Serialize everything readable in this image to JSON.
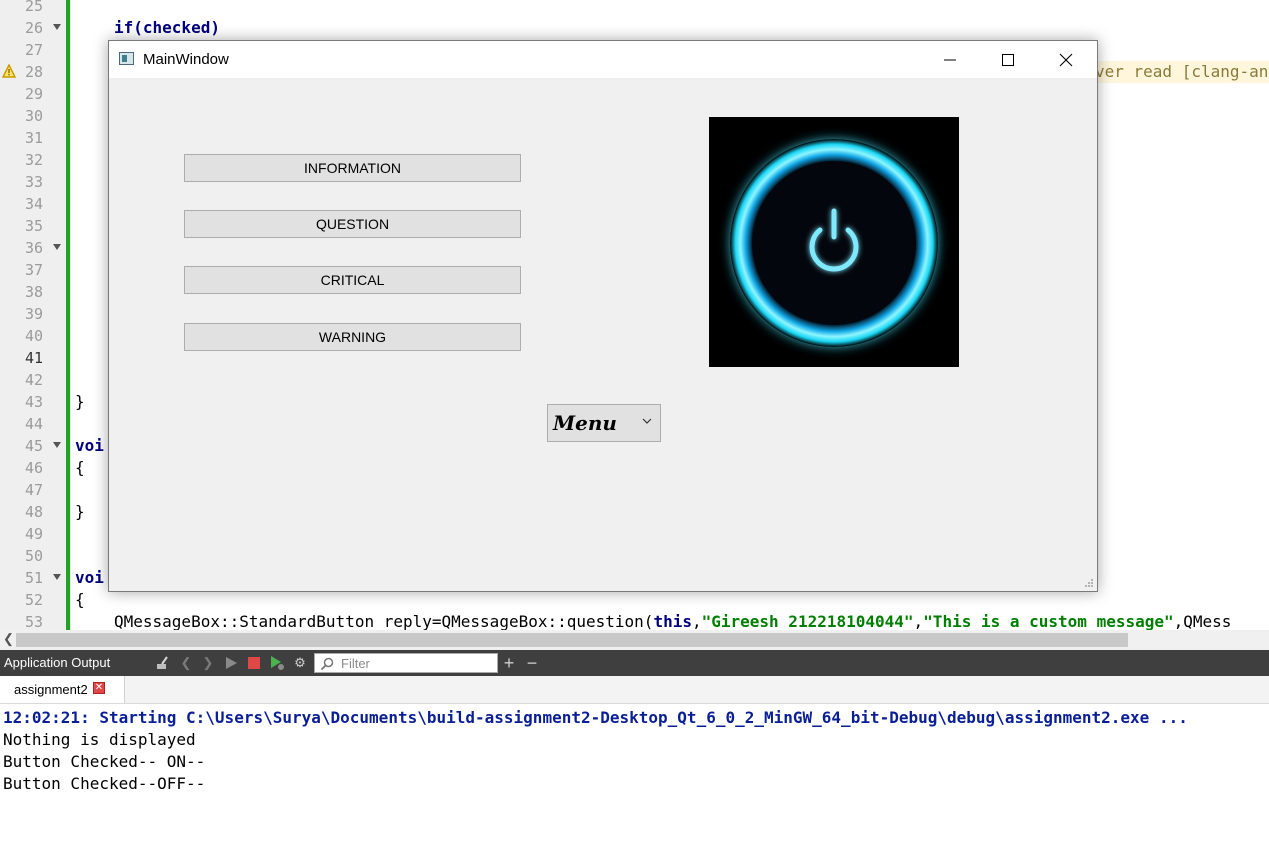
{
  "editor": {
    "line_numbers": [
      "25",
      "26",
      "27",
      "28",
      "29",
      "30",
      "31",
      "32",
      "33",
      "34",
      "35",
      "36",
      "37",
      "38",
      "39",
      "40",
      "41",
      "42",
      "43",
      "44",
      "45",
      "46",
      "47",
      "48",
      "49",
      "50",
      "51",
      "52",
      "53"
    ],
    "current_line": "41",
    "code": {
      "l26": "if(checked)",
      "l43": "}",
      "l45": "voi",
      "l46": "{",
      "l48": "}",
      "l51": "voi",
      "l52": "{",
      "l53_a": "QMessageBox::StandardButton reply=QMessageBox::question(",
      "l53_kw": "this",
      "l53_s1": "\"Gireesh 212218104044\"",
      "l53_s2": "\"This is a custom message\"",
      "l53_tail": ",QMess"
    },
    "warning_text": "ver read [clang-an"
  },
  "output_pane": {
    "title": "Application Output",
    "filter_placeholder": "Filter",
    "tab_label": "assignment2",
    "lines": [
      "12:02:21: Starting C:\\Users\\Surya\\Documents\\build-assignment2-Desktop_Qt_6_0_2_MinGW_64_bit-Debug\\debug\\assignment2.exe ...",
      "Nothing is displayed",
      "Button Checked-- ON--",
      "Button Checked--OFF--"
    ]
  },
  "main_window": {
    "title": "MainWindow",
    "buttons": [
      "INFORMATION",
      "QUESTION",
      "CRITICAL",
      "WARNING"
    ],
    "combo_value": "Menu",
    "image": "power-button-icon"
  },
  "colors": {
    "glow": "#19d6f5",
    "status_green": "#1fa51f",
    "console_blue": "#0a1f96"
  }
}
